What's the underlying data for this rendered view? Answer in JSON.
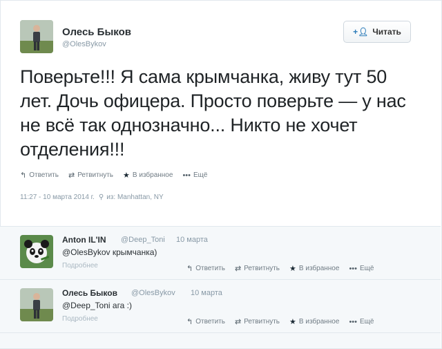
{
  "tweet": {
    "author_name": "Олесь Быков",
    "author_handle": "@OlesBykov",
    "follow_label": "Читать",
    "text": "Поверьте!!! Я сама крымчанка, живу тут 50 лет. Дочь офицера. Просто поверьте — у нас не всё так однозначно... Никто не хочет отделения!!!",
    "actions": {
      "reply": "Ответить",
      "retweet": "Ретвитнуть",
      "favorite": "В избранное",
      "more": "Ещё"
    },
    "timestamp": "11:27 - 10 марта 2014 г.",
    "location": "из: Manhattan, NY"
  },
  "replies": [
    {
      "name": "Anton IL'IN",
      "handle": "@Deep_Toni",
      "time": "10 марта",
      "text": "@OlesBykov крымчанка)",
      "more": "Подробнее",
      "actions": {
        "reply": "Ответить",
        "retweet": "Ретвитнуть",
        "favorite": "В избранное",
        "more": "Ещё"
      }
    },
    {
      "name": "Олесь Быков",
      "handle": "@OlesBykov",
      "time": "10 марта",
      "text": "@Deep_Toni ага :)",
      "more": "Подробнее",
      "actions": {
        "reply": "Ответить",
        "retweet": "Ретвитнуть",
        "favorite": "В избранное",
        "more": "Ещё"
      }
    }
  ],
  "icons": {
    "reply": "reply-icon",
    "retweet": "retweet-icon",
    "favorite": "star-icon",
    "more": "more-dots-icon",
    "location": "location-pin-icon",
    "follow": "add-user-icon"
  },
  "colors": {
    "link": "#2b7bb9",
    "muted": "#8899a6",
    "reply_bg": "#f5f8fa"
  }
}
